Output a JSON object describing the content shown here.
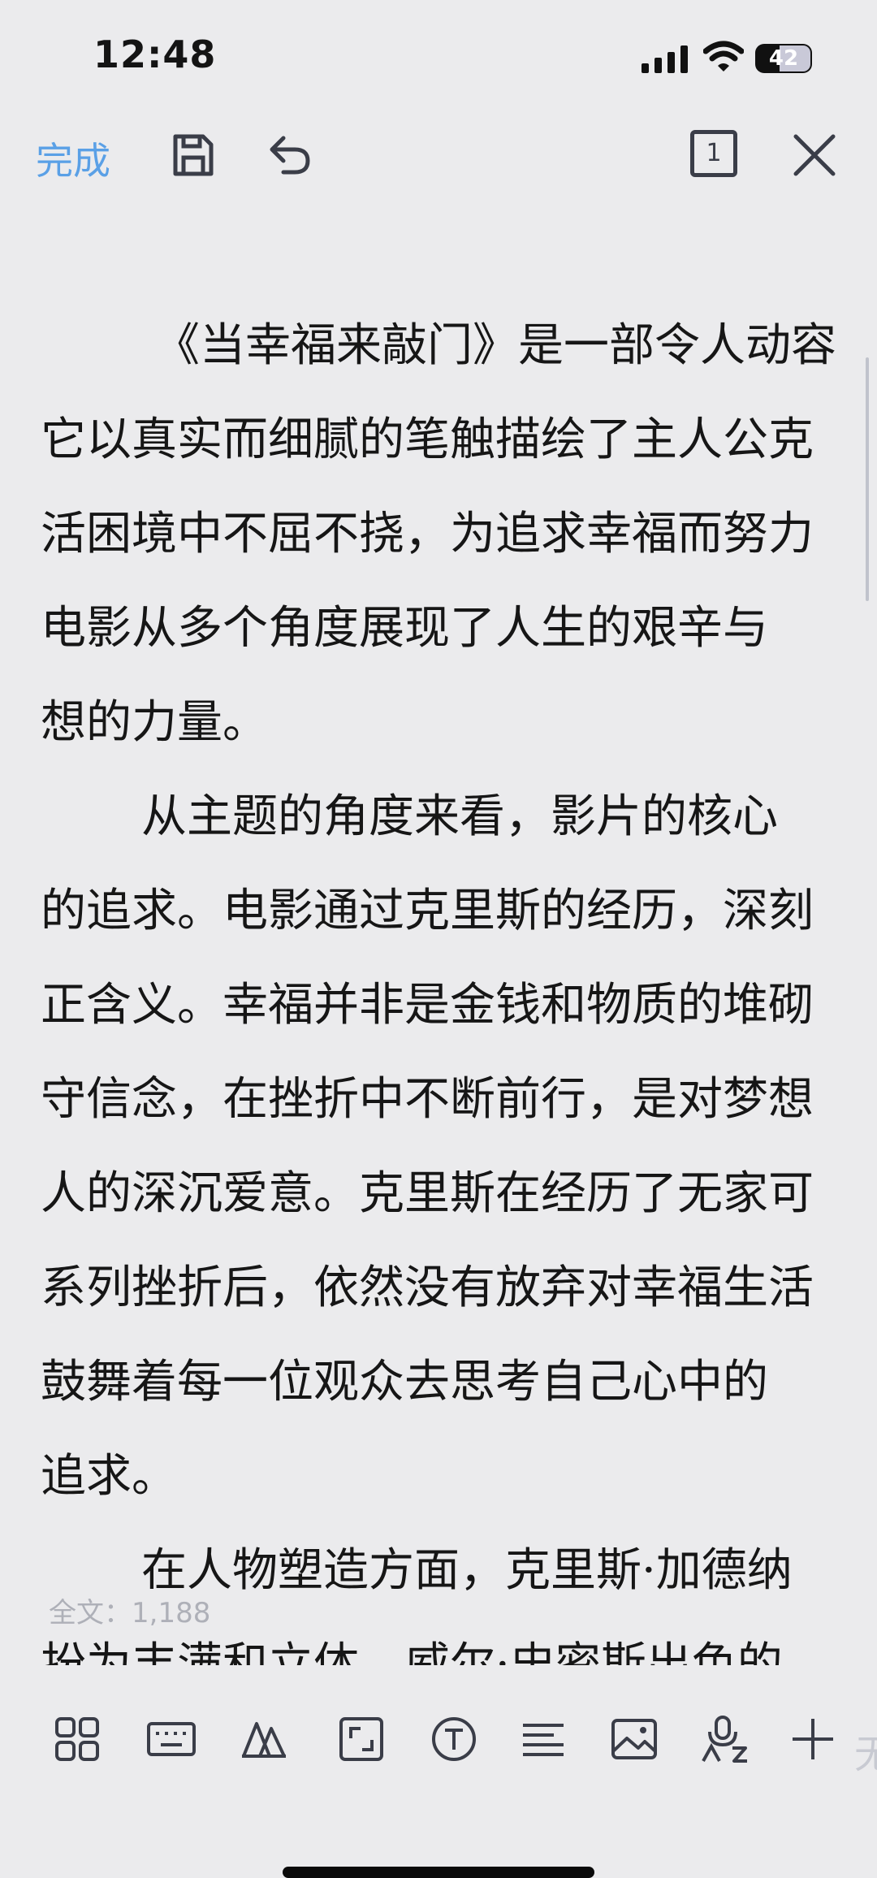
{
  "status": {
    "time": "12:48",
    "battery": "42"
  },
  "toolbar": {
    "done_label": "完成",
    "page_count": "1"
  },
  "document": {
    "lines": [
      "《当幸福来敲门》是一部令人动容",
      "它以真实而细腻的笔触描绘了主人公克",
      "活困境中不屈不挠，为追求幸福而努力",
      "电影从多个角度展现了人生的艰辛与",
      "想的力量。",
      "从主题的角度来看，影片的核心",
      "的追求。电影通过克里斯的经历，深刻",
      "正含义。幸福并非是金钱和物质的堆砌",
      "守信念，在挫折中不断前行，是对梦想",
      "人的深沉爱意。克里斯在经历了无家可",
      "系列挫折后，依然没有放弃对幸福生活",
      "鼓舞着每一位观众去思考自己心中的",
      "追求。",
      "在人物塑造方面，克里斯·加德纳",
      "扮为丰满和立体，威尔·史密斯出色的"
    ]
  },
  "word_count": "全文：1,188",
  "bottom_toolbar": {
    "faded_label": "无"
  }
}
